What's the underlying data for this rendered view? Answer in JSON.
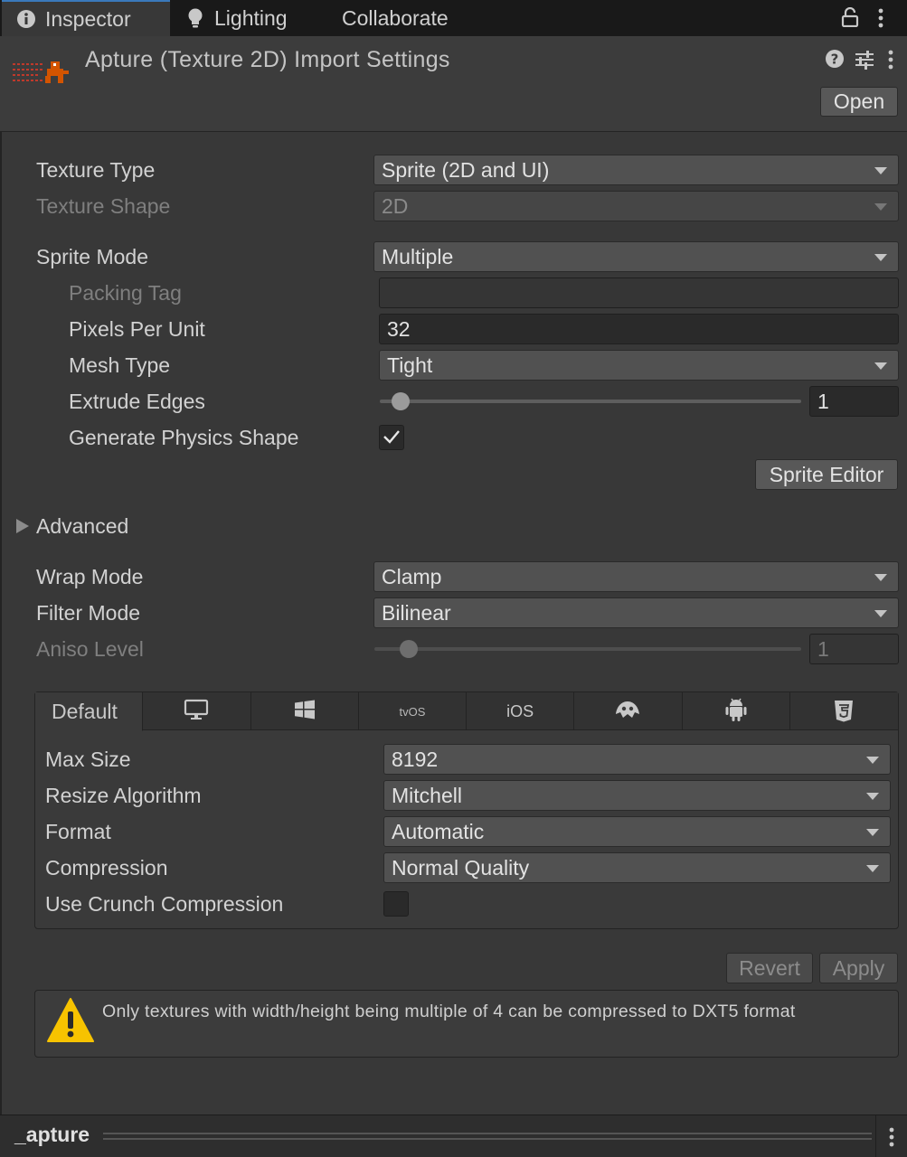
{
  "tabs": [
    {
      "label": "Inspector",
      "icon": "info-icon",
      "active": true
    },
    {
      "label": "Lighting",
      "icon": "lightbulb-icon",
      "active": false
    },
    {
      "label": "Collaborate",
      "active": false
    }
  ],
  "header": {
    "title": "Apture (Texture 2D) Import Settings",
    "open_label": "Open"
  },
  "fields": {
    "texture_type": {
      "label": "Texture Type",
      "value": "Sprite (2D and UI)"
    },
    "texture_shape": {
      "label": "Texture Shape",
      "value": "2D"
    },
    "sprite_mode": {
      "label": "Sprite Mode",
      "value": "Multiple"
    },
    "packing_tag": {
      "label": "Packing Tag",
      "value": ""
    },
    "pixels_per_unit": {
      "label": "Pixels Per Unit",
      "value": "32"
    },
    "mesh_type": {
      "label": "Mesh Type",
      "value": "Tight"
    },
    "extrude_edges": {
      "label": "Extrude Edges",
      "value": "1"
    },
    "generate_physics_shape": {
      "label": "Generate Physics Shape",
      "checked": true
    },
    "sprite_editor_label": "Sprite Editor",
    "advanced_label": "Advanced",
    "wrap_mode": {
      "label": "Wrap Mode",
      "value": "Clamp"
    },
    "filter_mode": {
      "label": "Filter Mode",
      "value": "Bilinear"
    },
    "aniso_level": {
      "label": "Aniso Level",
      "value": "1"
    }
  },
  "platform": {
    "tabs": [
      {
        "label": "Default",
        "active": true
      },
      {
        "icon": "monitor-icon"
      },
      {
        "icon": "windows-store-icon"
      },
      {
        "label": "tvOS"
      },
      {
        "label": "iOS"
      },
      {
        "icon": "webgl-icon"
      },
      {
        "icon": "android-icon"
      },
      {
        "icon": "html5-icon"
      }
    ],
    "max_size": {
      "label": "Max Size",
      "value": "8192"
    },
    "resize_algorithm": {
      "label": "Resize Algorithm",
      "value": "Mitchell"
    },
    "format": {
      "label": "Format",
      "value": "Automatic"
    },
    "compression": {
      "label": "Compression",
      "value": "Normal Quality"
    },
    "use_crunch": {
      "label": "Use Crunch Compression",
      "checked": false
    }
  },
  "actions": {
    "revert_label": "Revert",
    "apply_label": "Apply"
  },
  "warning": {
    "text": "Only textures with width/height being multiple of 4 can be compressed to DXT5 format",
    "icon": "warning-icon"
  },
  "footer": {
    "title": "_apture"
  },
  "colors": {
    "accent": "#3a79bb",
    "background": "#383838",
    "warning": "#f7c300"
  }
}
